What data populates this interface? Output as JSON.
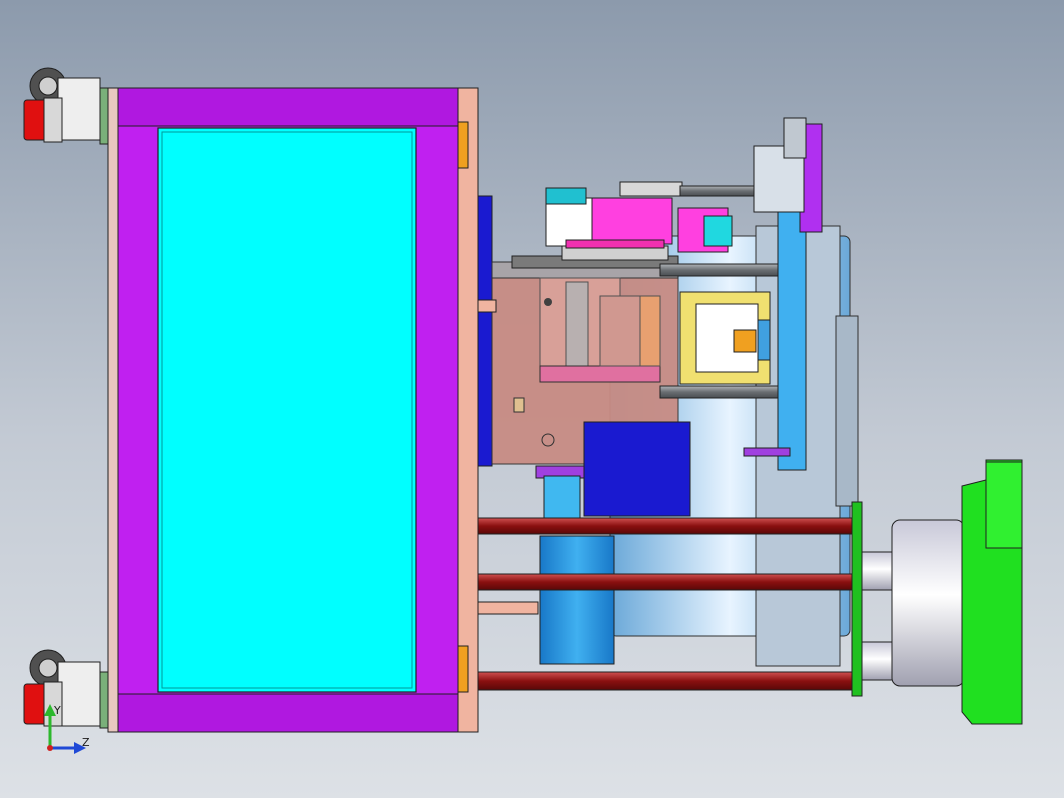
{
  "view": {
    "type": "cad-assembly-view",
    "background": "gradient",
    "background_colors": [
      "#8c9aac",
      "#dde1e6"
    ]
  },
  "triad": {
    "y_label": "Y",
    "z_label": "Z",
    "y_color": "#2db82d",
    "z_color": "#1f49d6"
  },
  "colors": {
    "frame_magenta": "#c020f0",
    "panel_cyan": "#00ffff",
    "plate_pink": "#f0b4a0",
    "mold_rose": "#c88c84",
    "block_blue": "#1a1ad0",
    "motor_blue": "#2090e0",
    "rod_red": "#a82020",
    "nozzle_green": "#20e020",
    "caster_red": "#e01010",
    "barrel_white": "#e8e8f0"
  }
}
